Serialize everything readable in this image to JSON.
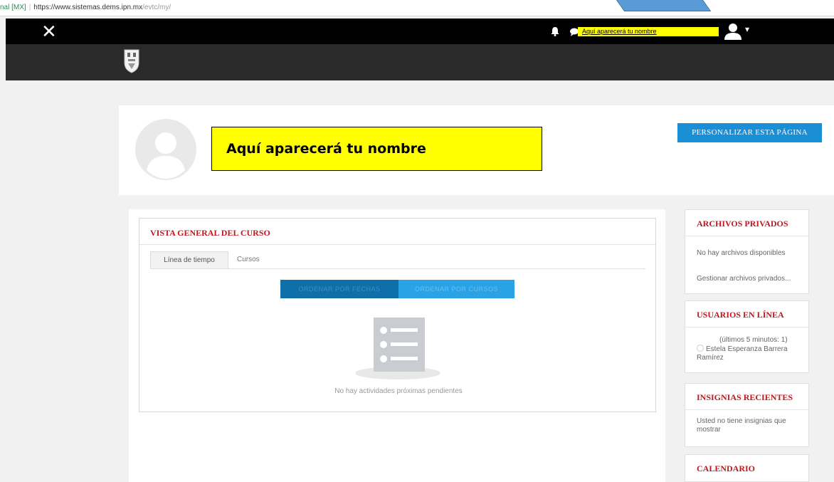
{
  "address_bar": {
    "security_label": "nal [MX]",
    "url_host": "https://www.sistemas.dems.ipn.mx",
    "url_path": "/evtc/my/"
  },
  "navbar": {
    "close_glyph": "✕",
    "user_name": "Aquí aparecerá tu nombre",
    "user_menu_caret": "▾"
  },
  "header": {
    "name_annotation": "Aquí aparecerá tu nombre",
    "customize_button": "PERSONALIZAR ESTA PÁGINA"
  },
  "course_overview": {
    "title": "VISTA GENERAL DEL CURSO",
    "tabs": [
      {
        "label": "Línea de tiempo"
      },
      {
        "label": "Cursos"
      }
    ],
    "sort_dates": "ORDENAR POR FECHAS",
    "sort_courses": "ORDENAR POR CURSOS",
    "empty_message": "No hay actividades próximas pendientes"
  },
  "blocks": {
    "private_files": {
      "title": "ARCHIVOS PRIVADOS",
      "empty": "No hay archivos disponibles",
      "manage_link": "Gestionar archivos privados..."
    },
    "online_users": {
      "title": "USUARIOS EN LÍNEA",
      "summary": "(últimos 5 minutos: 1)",
      "user_name": "Estela Esperanza Barrera Ramírez"
    },
    "recent_badges": {
      "title": "INSIGNIAS RECIENTES",
      "empty": "Usted no tiene insignias que mostrar"
    },
    "calendar": {
      "title": "CALENDARIO"
    }
  },
  "colors": {
    "accent_blue": "#1b8fd6",
    "block_title_red": "#c0171f",
    "highlight_yellow": "#ffff00",
    "navbar_black": "#000000"
  }
}
